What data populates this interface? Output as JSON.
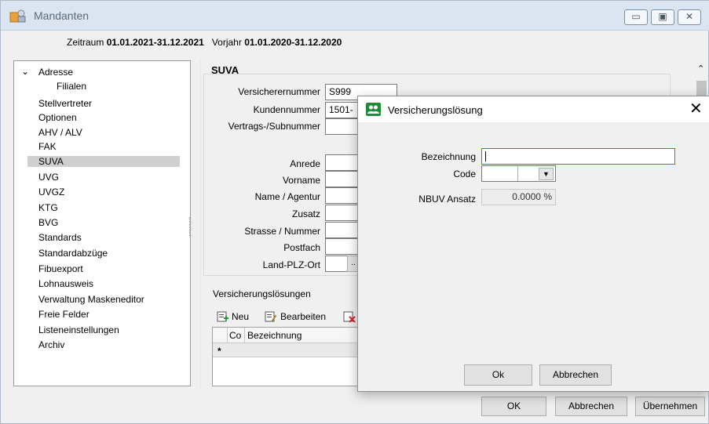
{
  "window": {
    "title": "Mandanten",
    "minimize": "▭",
    "maximize": "▣",
    "close": "✕"
  },
  "period": {
    "label": "Zeitraum",
    "value": "01.01.2021-31.12.2021",
    "prev_label": "Vorjahr",
    "prev_value": "01.01.2020-31.12.2020"
  },
  "tree": {
    "items": [
      {
        "label": "Adresse",
        "expanded": true
      },
      {
        "label": "Filialen",
        "child": true
      },
      {
        "label": "Stellvertreter"
      },
      {
        "label": "Optionen"
      },
      {
        "label": "AHV / ALV"
      },
      {
        "label": "FAK"
      },
      {
        "label": "SUVA",
        "selected": true
      },
      {
        "label": "UVG"
      },
      {
        "label": "UVGZ"
      },
      {
        "label": "KTG"
      },
      {
        "label": "BVG"
      },
      {
        "label": "Standards"
      },
      {
        "label": "Standardabzüge"
      },
      {
        "label": "Fibuexport"
      },
      {
        "label": "Lohnausweis"
      },
      {
        "label": "Verwaltung Maskeneditor"
      },
      {
        "label": "Freie Felder"
      },
      {
        "label": "Listeneinstellungen"
      },
      {
        "label": "Archiv"
      }
    ]
  },
  "suva": {
    "title": "SUVA",
    "fields": [
      {
        "label": "Versicherernummer",
        "value": "S999"
      },
      {
        "label": "Kundennummer",
        "value": "1501-"
      },
      {
        "label": "Vertrags-/Subnummer",
        "value": ""
      },
      {
        "label": "Anrede",
        "value": ""
      },
      {
        "label": "Vorname",
        "value": ""
      },
      {
        "label": "Name / Agentur",
        "value": ""
      },
      {
        "label": "Zusatz",
        "value": ""
      },
      {
        "label": "Strasse / Nummer",
        "value": ""
      },
      {
        "label": "Postfach",
        "value": ""
      },
      {
        "label": "Land-PLZ-Ort",
        "value": ""
      }
    ],
    "ellipsis": "..",
    "loesungen_label": "Versicherungslösungen",
    "toolbar": {
      "new": "Neu",
      "edit": "Bearbeiten"
    },
    "grid": {
      "columns": [
        "Co",
        "Bezeichnung"
      ],
      "new_row_marker": "*"
    }
  },
  "footer": {
    "ok": "OK",
    "cancel": "Abbrechen",
    "apply": "Übernehmen"
  },
  "dialog": {
    "title": "Versicherungslösung",
    "close": "✕",
    "bezeichnung_label": "Bezeichnung",
    "bezeichnung_value": "",
    "code_label": "Code",
    "code_value": "",
    "nbuv_label": "NBUV Ansatz",
    "nbuv_value": "0.0000 %",
    "ok": "Ok",
    "cancel": "Abbrechen"
  }
}
